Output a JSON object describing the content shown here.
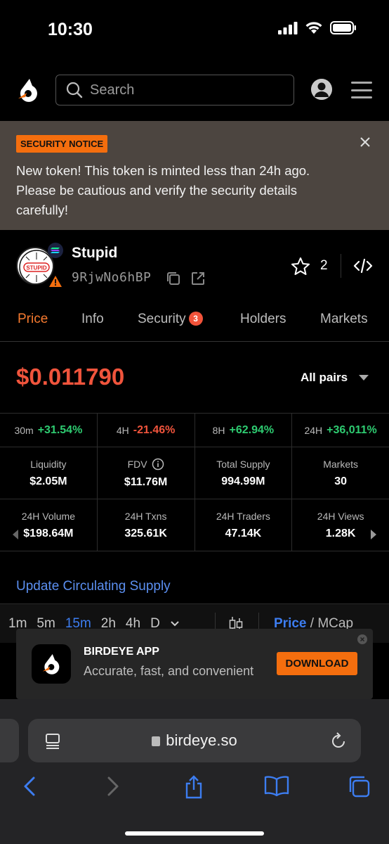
{
  "status": {
    "time": "10:30"
  },
  "header": {
    "search_placeholder": "Search"
  },
  "notice": {
    "badge": "SECURITY NOTICE",
    "text": "New token! This token is minted less than 24h ago. Please be cautious and verify the security details carefully!"
  },
  "token": {
    "name": "Stupid",
    "address": "9RjwNo6hBP",
    "avatar_text": "STUPID",
    "watch_count": "2"
  },
  "tabs": [
    {
      "label": "Price"
    },
    {
      "label": "Info"
    },
    {
      "label": "Security",
      "count": "3"
    },
    {
      "label": "Holders"
    },
    {
      "label": "Markets"
    }
  ],
  "price": {
    "value": "$0.011790",
    "pair_selector": "All pairs"
  },
  "timeframes": [
    {
      "label": "30m",
      "change": "+31.54%"
    },
    {
      "label": "4H",
      "change": "-21.46%"
    },
    {
      "label": "8H",
      "change": "+62.94%"
    },
    {
      "label": "24H",
      "change": "+36,011%"
    }
  ],
  "stats_row1": [
    {
      "label": "Liquidity",
      "value": "$2.05M"
    },
    {
      "label": "FDV",
      "value": "$11.76M"
    },
    {
      "label": "Total Supply",
      "value": "994.99M"
    },
    {
      "label": "Markets",
      "value": "30"
    }
  ],
  "stats_row2": [
    {
      "label": "24H Volume",
      "value": "$198.64M"
    },
    {
      "label": "24H Txns",
      "value": "325.61K"
    },
    {
      "label": "24H Traders",
      "value": "47.14K"
    },
    {
      "label": "24H Views",
      "value": "1.28K"
    }
  ],
  "update_link": "Update Circulating Supply",
  "chart_toolbar": {
    "intervals": [
      "1m",
      "5m",
      "15m",
      "2h",
      "4h",
      "D"
    ],
    "active_interval": "15m",
    "mode_price": "Price",
    "mode_sep": " / ",
    "mode_mcap": "MCap"
  },
  "app_banner": {
    "title": "BIRDEYE APP",
    "subtitle": "Accurate, fast, and convenient",
    "button": "DOWNLOAD"
  },
  "browser": {
    "url": "birdeye.so"
  },
  "colors": {
    "accent_orange": "#f46e0e",
    "price_red": "#f0543c",
    "positive_green": "#2ecc71",
    "link_blue": "#5b8ff0",
    "safari_blue": "#3d7df0"
  }
}
